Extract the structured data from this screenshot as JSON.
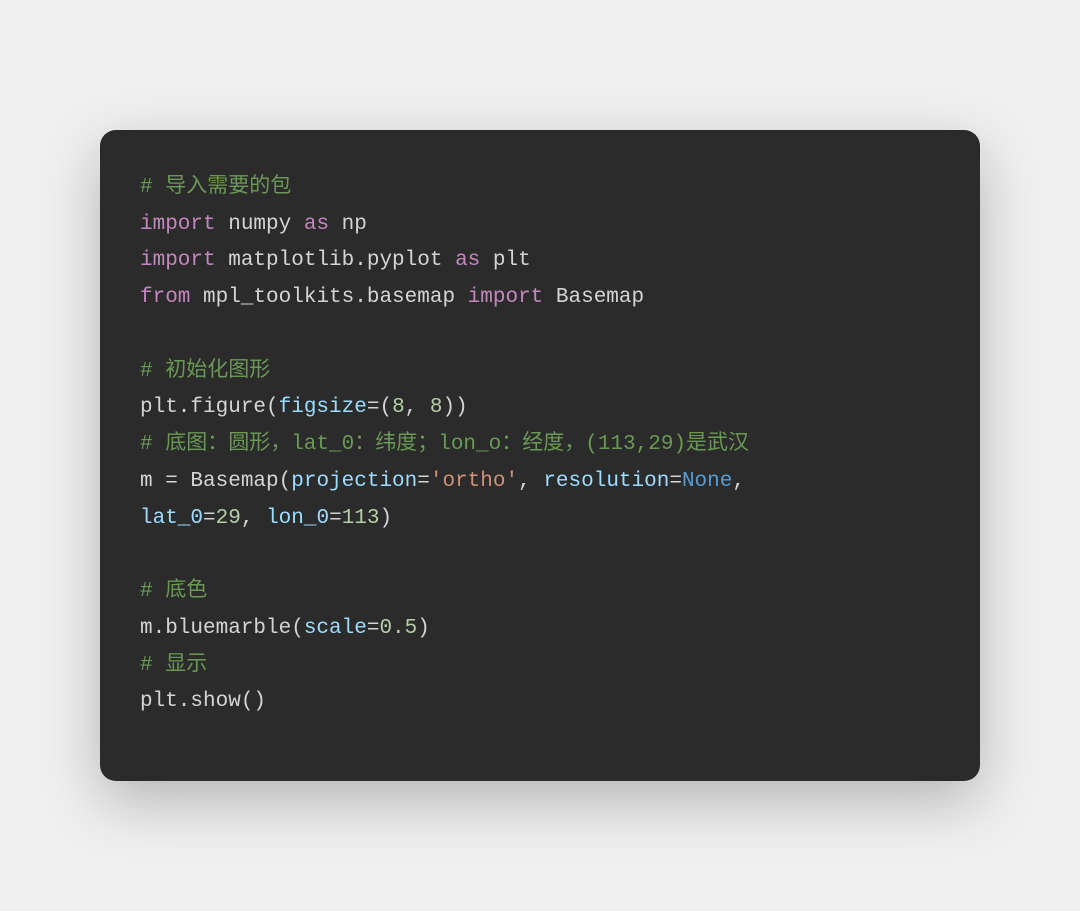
{
  "code": {
    "lines": [
      [
        {
          "cls": "tok-comment",
          "text": "# 导入需要的包"
        }
      ],
      [
        {
          "cls": "tok-keyword",
          "text": "import"
        },
        {
          "cls": "tok-default",
          "text": " numpy "
        },
        {
          "cls": "tok-keyword",
          "text": "as"
        },
        {
          "cls": "tok-default",
          "text": " np"
        }
      ],
      [
        {
          "cls": "tok-keyword",
          "text": "import"
        },
        {
          "cls": "tok-default",
          "text": " matplotlib.pyplot "
        },
        {
          "cls": "tok-keyword",
          "text": "as"
        },
        {
          "cls": "tok-default",
          "text": " plt"
        }
      ],
      [
        {
          "cls": "tok-keyword",
          "text": "from"
        },
        {
          "cls": "tok-default",
          "text": " mpl_toolkits.basemap "
        },
        {
          "cls": "tok-keyword",
          "text": "import"
        },
        {
          "cls": "tok-default",
          "text": " Basemap"
        }
      ],
      [
        {
          "cls": "tok-default",
          "text": ""
        }
      ],
      [
        {
          "cls": "tok-comment",
          "text": "# 初始化图形"
        }
      ],
      [
        {
          "cls": "tok-default",
          "text": "plt.figure("
        },
        {
          "cls": "tok-param",
          "text": "figsize"
        },
        {
          "cls": "tok-default",
          "text": "=("
        },
        {
          "cls": "tok-number",
          "text": "8"
        },
        {
          "cls": "tok-default",
          "text": ", "
        },
        {
          "cls": "tok-number",
          "text": "8"
        },
        {
          "cls": "tok-default",
          "text": "))"
        }
      ],
      [
        {
          "cls": "tok-comment",
          "text": "# 底图：圆形，lat_0：纬度；lon_o：经度，(113,29)是武汉"
        }
      ],
      [
        {
          "cls": "tok-default",
          "text": "m = Basemap("
        },
        {
          "cls": "tok-param",
          "text": "projection"
        },
        {
          "cls": "tok-default",
          "text": "="
        },
        {
          "cls": "tok-string",
          "text": "'ortho'"
        },
        {
          "cls": "tok-default",
          "text": ", "
        },
        {
          "cls": "tok-param",
          "text": "resolution"
        },
        {
          "cls": "tok-default",
          "text": "="
        },
        {
          "cls": "tok-const",
          "text": "None"
        },
        {
          "cls": "tok-default",
          "text": ", "
        }
      ],
      [
        {
          "cls": "tok-param",
          "text": "lat_0"
        },
        {
          "cls": "tok-default",
          "text": "="
        },
        {
          "cls": "tok-number",
          "text": "29"
        },
        {
          "cls": "tok-default",
          "text": ", "
        },
        {
          "cls": "tok-param",
          "text": "lon_0"
        },
        {
          "cls": "tok-default",
          "text": "="
        },
        {
          "cls": "tok-number",
          "text": "113"
        },
        {
          "cls": "tok-default",
          "text": ")"
        }
      ],
      [
        {
          "cls": "tok-default",
          "text": ""
        }
      ],
      [
        {
          "cls": "tok-comment",
          "text": "# 底色"
        }
      ],
      [
        {
          "cls": "tok-default",
          "text": "m.bluemarble("
        },
        {
          "cls": "tok-param",
          "text": "scale"
        },
        {
          "cls": "tok-default",
          "text": "="
        },
        {
          "cls": "tok-number",
          "text": "0.5"
        },
        {
          "cls": "tok-default",
          "text": ")"
        }
      ],
      [
        {
          "cls": "tok-comment",
          "text": "# 显示"
        }
      ],
      [
        {
          "cls": "tok-default",
          "text": "plt.show()"
        }
      ]
    ]
  }
}
